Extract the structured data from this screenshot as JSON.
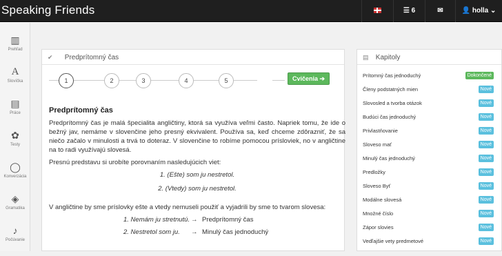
{
  "header": {
    "brand": "Speaking Friends",
    "tasks_count": "6",
    "user_name": "holla"
  },
  "sidebar": {
    "items": [
      {
        "label": "Prehľad",
        "icon": "bar-chart-icon"
      },
      {
        "label": "Slovíčka",
        "icon": "font-icon"
      },
      {
        "label": "Práce",
        "icon": "book-icon"
      },
      {
        "label": "Testy",
        "icon": "palette-icon"
      },
      {
        "label": "Konverzácia",
        "icon": "chat-icon"
      },
      {
        "label": "Gramatika",
        "icon": "eraser-icon"
      },
      {
        "label": "Počúvanie",
        "icon": "music-icon"
      }
    ]
  },
  "main": {
    "title": "Predprítomný čas",
    "steps": [
      "1",
      "2",
      "3",
      "4",
      "5"
    ],
    "exercise_button": "Cvičenia",
    "heading": "Predprítomný čas",
    "para1": "Predprítomný čas je malá špecialita angličtiny, ktorá sa využíva veľmi často. Napriek tomu, že ide o bežný jav, nemáme v slovenčine jeho presný ekvivalent. Používa sa, keď chceme zdôrazniť, že sa niečo začalo v minulosti a trvá to doteraz. V slovenčine to robíme pomocou prísloviek, no v angličtine na to radi využívajú slovesá.",
    "para2": "Presnú predstavu si urobíte porovnaním nasledujúcich viet:",
    "example1": "1. (Ešte) som ju nestretol.",
    "example2": "2. (Vtedy) som ju nestretol.",
    "para3": "V angličtine by sme príslovky ešte a vtedy nemuseli použiť a vyjadrili by sme to tvarom slovesa:",
    "arrow_rows": [
      {
        "left": "1. Nemám ju stretnutú.",
        "arrow": "→",
        "right": "Predprítomný čas"
      },
      {
        "left": "2. Nestretol som ju.",
        "arrow": "→",
        "right": "Minulý čas jednoduchý"
      }
    ]
  },
  "chapters": {
    "title": "Kapitoly",
    "items": [
      {
        "label": "Prítomný čas jednoduchý",
        "badge": "Dokončené",
        "status": "done"
      },
      {
        "label": "Členy podstatných mien",
        "badge": "Nové",
        "status": "new"
      },
      {
        "label": "Slovosled a tvorba otázok",
        "badge": "Nové",
        "status": "new"
      },
      {
        "label": "Budúci čas jednoduchý",
        "badge": "Nové",
        "status": "new"
      },
      {
        "label": "Privlastňovanie",
        "badge": "Nové",
        "status": "new"
      },
      {
        "label": "Sloveso mať",
        "badge": "Nové",
        "status": "new"
      },
      {
        "label": "Minulý čas jednoduchý",
        "badge": "Nové",
        "status": "new"
      },
      {
        "label": "Predložky",
        "badge": "Nové",
        "status": "new"
      },
      {
        "label": "Sloveso Byť",
        "badge": "Nové",
        "status": "new"
      },
      {
        "label": "Modálne slovesá",
        "badge": "Nové",
        "status": "new"
      },
      {
        "label": "Množné číslo",
        "badge": "Nové",
        "status": "new"
      },
      {
        "label": "Zápor slovies",
        "badge": "Nové",
        "status": "new"
      },
      {
        "label": "Vedľajšie vety predmetové",
        "badge": "Nové",
        "status": "new"
      }
    ]
  },
  "colors": {
    "done": "#5cb85c",
    "new": "#5bc0de",
    "topbar": "#1f1f1f"
  }
}
